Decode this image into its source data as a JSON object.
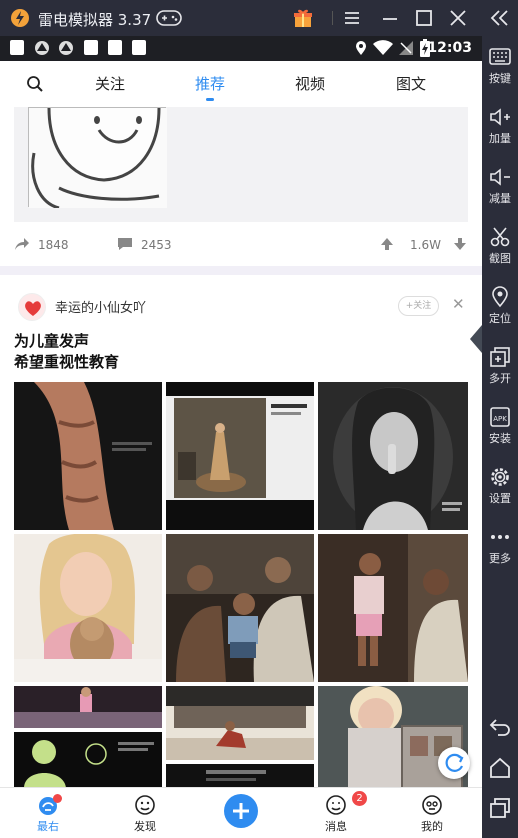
{
  "emulator": {
    "title": "雷电模拟器 3.37",
    "sidebar": [
      {
        "label": "按键",
        "icon": "keyboard-icon"
      },
      {
        "label": "加量",
        "icon": "volume-up-icon"
      },
      {
        "label": "减量",
        "icon": "volume-down-icon"
      },
      {
        "label": "截图",
        "icon": "scissors-icon"
      },
      {
        "label": "定位",
        "icon": "location-pin-icon"
      },
      {
        "label": "多开",
        "icon": "multi-instance-icon"
      },
      {
        "label": "安装",
        "icon": "apk-install-icon"
      },
      {
        "label": "设置",
        "icon": "gear-icon"
      },
      {
        "label": "更多",
        "icon": "more-dots-icon"
      }
    ],
    "nav_buttons": [
      "back-icon",
      "home-icon",
      "recents-icon"
    ]
  },
  "status_bar": {
    "time": "12:03"
  },
  "top_tabs": [
    {
      "label": "关注"
    },
    {
      "label": "推荐",
      "active": true
    },
    {
      "label": "视频"
    },
    {
      "label": "图文"
    }
  ],
  "prev_post": {
    "shares": "1848",
    "comments": "2453",
    "likes": "1.6W"
  },
  "post": {
    "author": "幸运的小仙女吖",
    "follow_label": "+关注",
    "text_line1": "为儿童发声",
    "text_line2": "希望重视性教育"
  },
  "bottom_nav": [
    {
      "label": "最右",
      "active": true
    },
    {
      "label": "发现"
    },
    {
      "label": "消息",
      "badge": "2"
    },
    {
      "label": "我的"
    }
  ],
  "colors": {
    "accent": "#2f8cf0",
    "badge": "#f04848"
  }
}
